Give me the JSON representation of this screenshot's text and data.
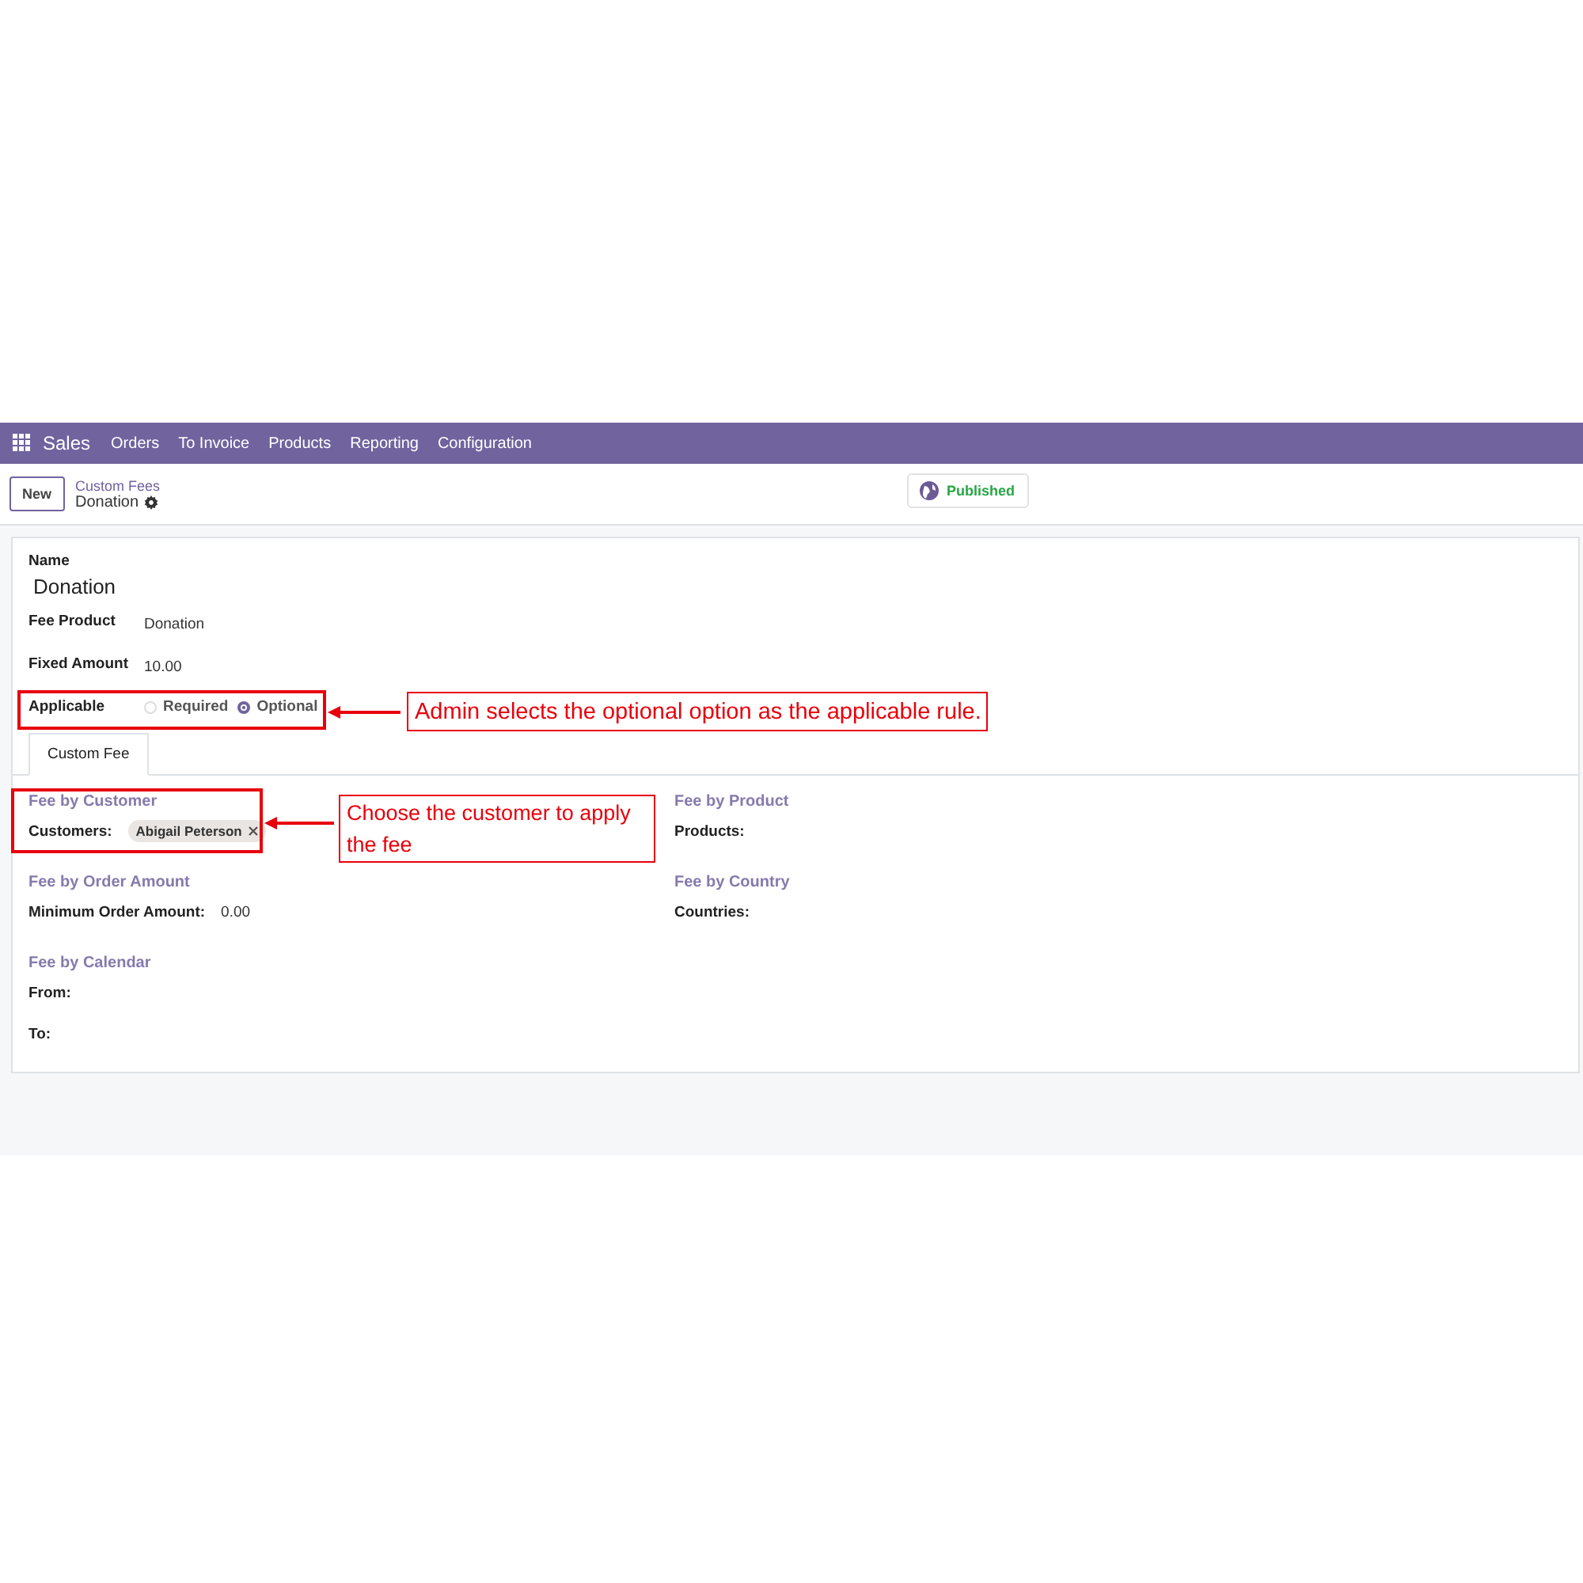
{
  "navbar": {
    "app": "Sales",
    "menu": [
      "Orders",
      "To Invoice",
      "Products",
      "Reporting",
      "Configuration"
    ]
  },
  "control_panel": {
    "new_button": "New",
    "breadcrumb": "Custom Fees",
    "record": "Donation",
    "status": "Published"
  },
  "form": {
    "name_label": "Name",
    "name": "Donation",
    "fields": [
      {
        "label": "Fee Product",
        "value": "Donation"
      },
      {
        "label": "Fixed Amount",
        "value": "10.00"
      }
    ],
    "applicable": {
      "label": "Applicable",
      "options": [
        {
          "label": "Required",
          "selected": false
        },
        {
          "label": "Optional",
          "selected": true
        }
      ]
    },
    "tabs": [
      {
        "label": "Custom Fee",
        "selected": true
      }
    ],
    "left_sections": [
      {
        "title": "Fee by Customer",
        "rows": [
          {
            "label": "Customers:",
            "tags": [
              "Abigail Peterson"
            ]
          }
        ]
      },
      {
        "title": "Fee by Order Amount",
        "rows": [
          {
            "label": "Minimum Order Amount:",
            "value": "0.00"
          }
        ]
      },
      {
        "title": "Fee by Calendar",
        "rows": [
          {
            "label": "From:"
          },
          {
            "label": "To:"
          }
        ]
      }
    ],
    "right_sections": [
      {
        "title": "Fee by Product",
        "rows": [
          {
            "label": "Products:"
          }
        ]
      },
      {
        "title": "Fee by Country",
        "rows": [
          {
            "label": "Countries:"
          }
        ]
      }
    ]
  },
  "annotations": [
    {
      "text": "Admin selects the optional option as the applicable rule."
    },
    {
      "text": "Choose the customer to apply the fee"
    }
  ]
}
